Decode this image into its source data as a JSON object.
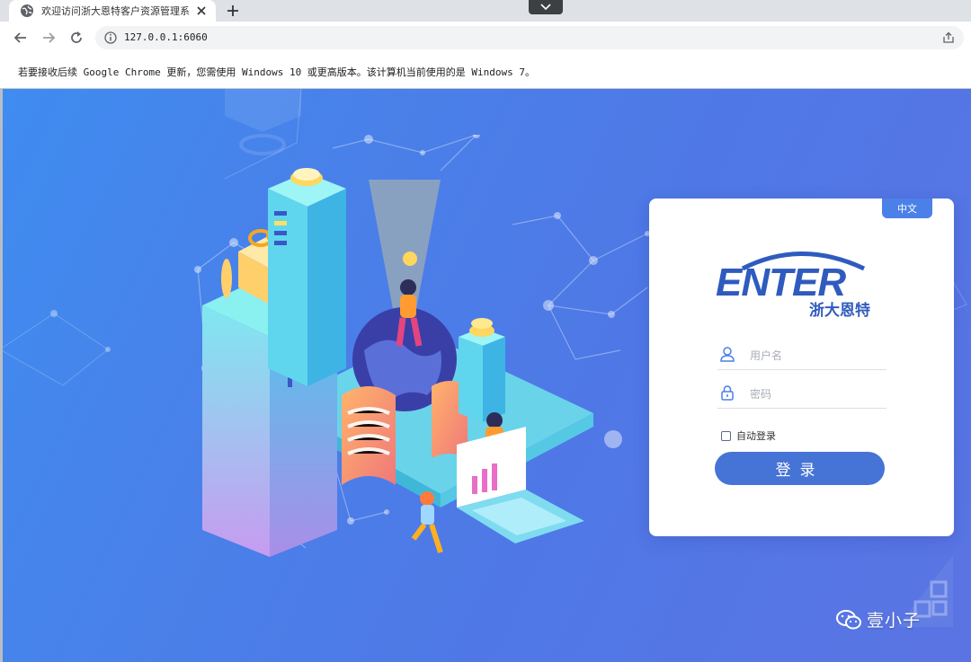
{
  "browser": {
    "tab_title": "欢迎访问浙大恩特客户资源管理系统",
    "url": "127.0.0.1:6060",
    "infobar_text": "若要接收后续 Google Chrome 更新，您需使用 Windows 10 或更高版本。该计算机当前使用的是 Windows 7。"
  },
  "login": {
    "lang_label": "中文",
    "brand_name": "ENTER",
    "brand_cn": "浙大恩特",
    "username_placeholder": "用户名",
    "password_placeholder": "密码",
    "remember_label": "自动登录",
    "login_label": "登录"
  },
  "watermark": {
    "text": "壹小子"
  },
  "colors": {
    "accent": "#4673d6",
    "brand": "#2f5bbf",
    "bg_from": "#3f8cf0",
    "bg_to": "#5b74e4"
  },
  "icons": [
    "globe-icon",
    "close-icon",
    "plus-icon",
    "chevron-down-icon",
    "back-icon",
    "forward-icon",
    "reload-icon",
    "info-icon",
    "share-icon",
    "user-icon",
    "lock-icon",
    "wechat-icon"
  ]
}
